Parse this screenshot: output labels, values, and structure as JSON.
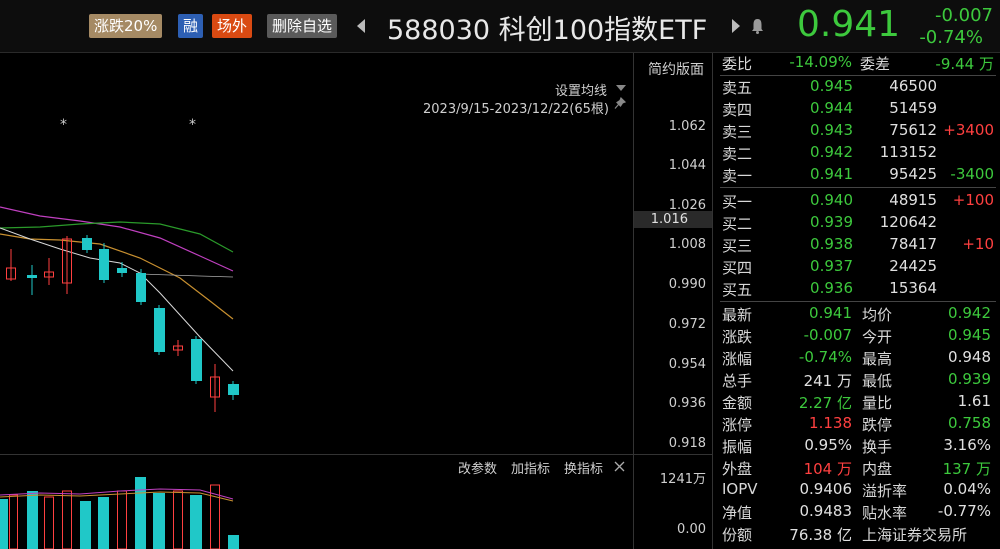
{
  "header": {
    "tag_limit": "涨跌20%",
    "tag_margin": "融",
    "tag_offsite": "场外",
    "tag_remove": "删除自选",
    "title": "588030 科创100指数ETF",
    "price": "0.941",
    "change": "-0.007",
    "change_pct": "-0.74%"
  },
  "chart": {
    "simple_mode": "简约版面",
    "set_ma": "设置均线",
    "range": "2023/9/15-2023/12/22(65根)",
    "y_ticks": [
      "1.062",
      "1.044",
      "1.026",
      "1.008",
      "0.990",
      "0.972",
      "0.954",
      "0.936",
      "0.918"
    ],
    "crosshair_value": "1.016",
    "vol_top": "1241万",
    "vol_bottom": "0.00",
    "indicator_params": "改参数",
    "add_indicator": "加指标",
    "switch_indicator": "换指标",
    "markers": [
      "*",
      "*"
    ]
  },
  "orderbook": {
    "wei_bi_label": "委比",
    "wei_bi": "-14.09%",
    "wei_cha_label": "委差",
    "wei_cha": "-9.44 万",
    "asks": [
      {
        "label": "卖五",
        "price": "0.945",
        "vol": "46500",
        "delta": ""
      },
      {
        "label": "卖四",
        "price": "0.944",
        "vol": "51459",
        "delta": ""
      },
      {
        "label": "卖三",
        "price": "0.943",
        "vol": "75612",
        "delta": "+3400"
      },
      {
        "label": "卖二",
        "price": "0.942",
        "vol": "113152",
        "delta": ""
      },
      {
        "label": "卖一",
        "price": "0.941",
        "vol": "95425",
        "delta": "-3400"
      }
    ],
    "bids": [
      {
        "label": "买一",
        "price": "0.940",
        "vol": "48915",
        "delta": "+100"
      },
      {
        "label": "买二",
        "price": "0.939",
        "vol": "120642",
        "delta": ""
      },
      {
        "label": "买三",
        "price": "0.938",
        "vol": "78417",
        "delta": "+10"
      },
      {
        "label": "买四",
        "price": "0.937",
        "vol": "24425",
        "delta": ""
      },
      {
        "label": "买五",
        "price": "0.936",
        "vol": "15364",
        "delta": ""
      }
    ]
  },
  "stats": [
    {
      "l1": "最新",
      "v1": "0.941",
      "c1": "g",
      "l2": "均价",
      "v2": "0.942",
      "c2": "g"
    },
    {
      "l1": "涨跌",
      "v1": "-0.007",
      "c1": "g",
      "l2": "今开",
      "v2": "0.945",
      "c2": "g"
    },
    {
      "l1": "涨幅",
      "v1": "-0.74%",
      "c1": "g",
      "l2": "最高",
      "v2": "0.948",
      "c2": "w"
    },
    {
      "l1": "总手",
      "v1": "241 万",
      "c1": "w",
      "l2": "最低",
      "v2": "0.939",
      "c2": "g"
    },
    {
      "l1": "金额",
      "v1": "2.27 亿",
      "c1": "g",
      "l2": "量比",
      "v2": "1.61",
      "c2": "w"
    },
    {
      "l1": "涨停",
      "v1": "1.138",
      "c1": "r",
      "l2": "跌停",
      "v2": "0.758",
      "c2": "g"
    },
    {
      "l1": "振幅",
      "v1": "0.95%",
      "c1": "w",
      "l2": "换手",
      "v2": "3.16%",
      "c2": "w"
    },
    {
      "l1": "外盘",
      "v1": "104 万",
      "c1": "r",
      "l2": "内盘",
      "v2": "137 万",
      "c2": "g"
    },
    {
      "l1": "IOPV",
      "v1": "0.9406",
      "c1": "w",
      "l2": "溢折率",
      "v2": "0.04%",
      "c2": "w"
    },
    {
      "l1": "净值",
      "v1": "0.9483",
      "c1": "w",
      "l2": "贴水率",
      "v2": "-0.77%",
      "c2": "w"
    },
    {
      "l1": "份额",
      "v1": "76.38 亿",
      "c1": "w",
      "l2": "上海证券交易所",
      "v2": "",
      "c2": "w"
    }
  ],
  "colors": {
    "up": "#ff4040",
    "down": "#3dc93d",
    "candle_down": "#20c8c8",
    "bg": "#000000"
  }
}
